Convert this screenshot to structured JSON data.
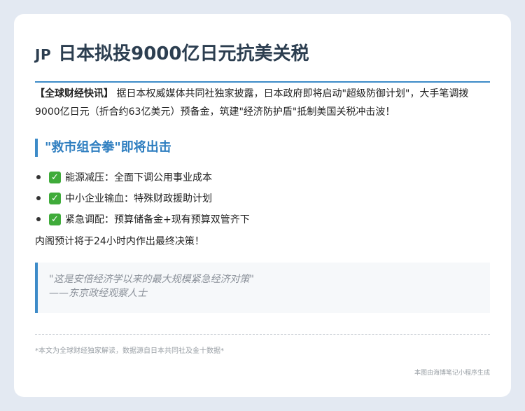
{
  "header": {
    "flag_code": "JP",
    "title": "日本拟投9000亿日元抗美关税"
  },
  "lead": {
    "tag": "【全球财经快讯】",
    "text": " 据日本权威媒体共同社独家披露，日本政府即将启动\"超级防御计划\"，大手笔调拨9000亿日元（折合约63亿美元）预备金，筑建\"经济防护盾\"抵制美国关税冲击波！"
  },
  "section": {
    "heading": "\"救市组合拳\"即将出击",
    "items": [
      {
        "icon": "check-mark-icon",
        "text": "能源减压：全面下调公用事业成本"
      },
      {
        "icon": "check-mark-icon",
        "text": "中小企业输血：特殊财政援助计划"
      },
      {
        "icon": "check-mark-icon",
        "text": "紧急调配：预算储备金+现有预算双管齐下"
      }
    ],
    "outro": "内阁预计将于24小时内作出最终决策！"
  },
  "quote": {
    "line1": "\"这是安倍经济学以来的最大规模紧急经济对策\"",
    "line2": "——东京政经观察人士"
  },
  "footer": {
    "footnote": "*本文为全球财经独家解读，数据源自日本共同社及金十数据*",
    "credit": "本图由海博笔记小程序生成"
  },
  "colors": {
    "accent": "#3d8bc8",
    "title": "#2c3e50",
    "check": "#3fab3a",
    "background": "#e3e9f2"
  }
}
